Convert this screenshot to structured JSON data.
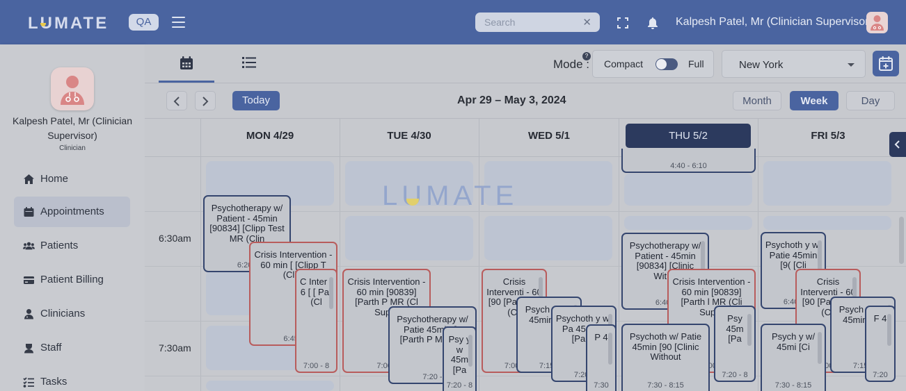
{
  "header": {
    "logo": "LUMATE",
    "env_badge": "QA",
    "search": {
      "placeholder": "Search",
      "value": "",
      "clear_glyph": "✕"
    },
    "user_name": "Kalpesh Patel, Mr (Clinician Supervisor)"
  },
  "sidebar": {
    "profile_name": "Kalpesh Patel, Mr (Clinician Supervisor)",
    "profile_role": "Clinician",
    "items": [
      {
        "label": "Home",
        "icon": "home-icon",
        "active": false
      },
      {
        "label": "Appointments",
        "icon": "calendar-icon",
        "active": true
      },
      {
        "label": "Patients",
        "icon": "patients-icon",
        "active": false
      },
      {
        "label": "Patient Billing",
        "icon": "credit-card-icon",
        "active": false
      },
      {
        "label": "Clinicians",
        "icon": "clinician-icon",
        "active": false
      },
      {
        "label": "Staff",
        "icon": "staff-icon",
        "active": false
      },
      {
        "label": "Tasks",
        "icon": "tasks-icon",
        "active": false
      }
    ]
  },
  "toolbar": {
    "mode_label": "Mode :",
    "mode_help": "?",
    "mode_compact": "Compact",
    "mode_full": "Full",
    "location": "New York",
    "today_label": "Today",
    "date_range": "Apr 29 – May 3, 2024",
    "range_buttons": {
      "month": "Month",
      "week": "Week",
      "day": "Day"
    },
    "active_range": "Week"
  },
  "calendar": {
    "days": [
      "MON 4/29",
      "TUE 4/30",
      "WED 5/1",
      "THU 5/2",
      "FRI 5/3"
    ],
    "today_index": 3,
    "time_labels": [
      "6:30am",
      "7:30am"
    ],
    "watermark": "LUMATE",
    "appointments": [
      {
        "text": "",
        "time": "4:40 - 6:10"
      },
      {
        "text": "Psychotherapy w/ Patient - 45min [90834] [Clipp Test MR (Clin",
        "time": "6:20 -"
      },
      {
        "text": "Crisis Intervention - 60 min [ [Clipp T (Clini",
        "time": "6:45 -"
      },
      {
        "text": "C Inter - 6 [ [ Par (Cl",
        "time": "7:00 - 8"
      },
      {
        "text": "Crisis Intervention - 60 min [90839] [Parth P MR (Cl Super",
        "time": "7:00 -"
      },
      {
        "text": "Psychotherapy w/ Patie 45min [9 [Parth P MR (Cli",
        "time": "7:20 -"
      },
      {
        "text": "Psy y w 45m [Pa",
        "time": "7:20 - 8"
      },
      {
        "text": "Crisis Interventi - 60 [90 [Pa Parik (Cli",
        "time": "7:00 -"
      },
      {
        "text": "Psych y w/ l 45min [Cli",
        "time": "7:15 -"
      },
      {
        "text": "Psychoth y w/ Pa 45min [ [Parth",
        "time": "7:20 -"
      },
      {
        "text": "P 4",
        "time": "7:30"
      },
      {
        "text": "Psychotherapy w/ Patient - 45min [90834] [Clinic Witho",
        "time": "6:40 -"
      },
      {
        "text": "Crisis Intervention - 60 min [90839] [Parth l MR (Cli Super",
        "time": "7:00 -"
      },
      {
        "text": "Psy 45m [Pa",
        "time": "7:20 - 8"
      },
      {
        "text": "Psychoth w/ Patie 45min [90 [Clinic Without",
        "time": "7:30 - 8:15"
      },
      {
        "text": "Psychoth y w/ Patie 45min [9( [Cli",
        "time": "6:40 -"
      },
      {
        "text": "Crisis Interventi - 60 [90 [Pa Parik (Cli",
        "time": "7:00 -"
      },
      {
        "text": "Psych y w/ l 45min [Cli",
        "time": "7:15 -"
      },
      {
        "text": "F 4",
        "time": "7:20"
      },
      {
        "text": "Psych y w/ 45mi [Ci",
        "time": "7:30 - 8:15"
      }
    ]
  },
  "colors": {
    "primary": "#4a64a0",
    "today_header": "#2c3a5e",
    "appt_border_blue": "#34456e",
    "appt_border_red": "#b85c5c",
    "overlay_tint": "#c8cacf"
  }
}
